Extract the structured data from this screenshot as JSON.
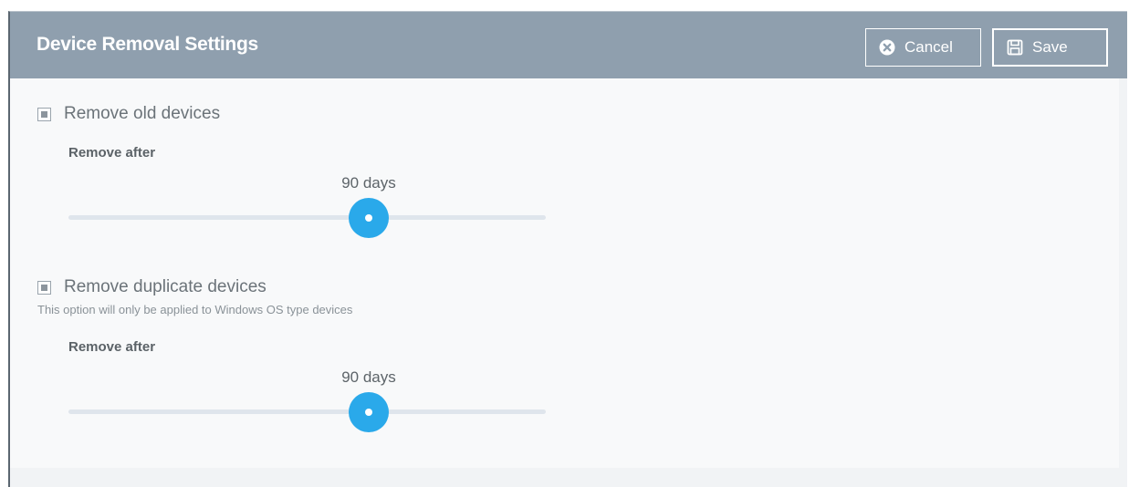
{
  "header": {
    "title": "Device Removal Settings",
    "cancel_label": "Cancel",
    "save_label": "Save"
  },
  "sections": [
    {
      "checkbox_label": "Remove old devices",
      "checked": true,
      "hint": "",
      "sub_label": "Remove after",
      "slider_value_text": "90 days",
      "slider_fraction": 0.63
    },
    {
      "checkbox_label": "Remove duplicate devices",
      "checked": true,
      "hint": "This option will only be applied to Windows OS type devices",
      "sub_label": "Remove after",
      "slider_value_text": "90 days",
      "slider_fraction": 0.63
    }
  ],
  "colors": {
    "header_bg": "#8f9fae",
    "accent": "#2aa9ea",
    "track": "#dfe5ec"
  },
  "icons": {
    "cancel": "close-circle-icon",
    "save": "floppy-disk-icon"
  }
}
